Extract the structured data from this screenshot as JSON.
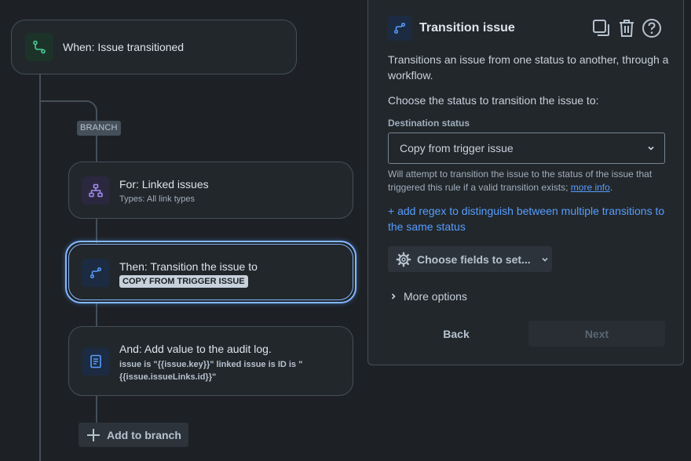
{
  "flow": {
    "trigger": {
      "title": "When: Issue transitioned",
      "icon": "transition-trigger-icon"
    },
    "branch_tag": "BRANCH",
    "branch_card": {
      "title": "For: Linked issues",
      "subtitle": "Types: All link types",
      "icon": "hierarchy-icon"
    },
    "action_card": {
      "title": "Then: Transition the issue to",
      "lozenge": "COPY FROM TRIGGER ISSUE",
      "icon": "transition-icon"
    },
    "audit_card": {
      "title": "And: Add value to the audit log.",
      "text": "issue is \"{{issue.key}}\" linked issue is ID is \"{{issue.issueLinks.id}}\"",
      "icon": "document-icon"
    },
    "add_branch_label": "Add to branch"
  },
  "panel": {
    "title": "Transition issue",
    "description": "Transitions an issue from one status to another, through a workflow.",
    "choose_label": "Choose the status to transition the issue to:",
    "field_label": "Destination status",
    "select_value": "Copy from trigger issue",
    "helper_text": "Will attempt to transition the issue to the status of the issue that triggered this rule if a valid transition exists;",
    "helper_link": "more info",
    "helper_end": ".",
    "regex_link": "+ add regex to distinguish between multiple transitions to the same status",
    "fields_button": "Choose fields to set...",
    "more_options": "More options",
    "back_label": "Back",
    "next_label": "Next"
  },
  "colors": {
    "background": "#1d2125",
    "accent": "#579dff",
    "selected_border": "#85b8ff",
    "trigger_icon_bg": "#1c3329",
    "trigger_icon": "#4bce97",
    "branch_icon_bg": "#2b273f",
    "branch_icon": "#9f8fef",
    "action_icon_bg": "#1c2b41",
    "action_icon": "#579dff"
  }
}
